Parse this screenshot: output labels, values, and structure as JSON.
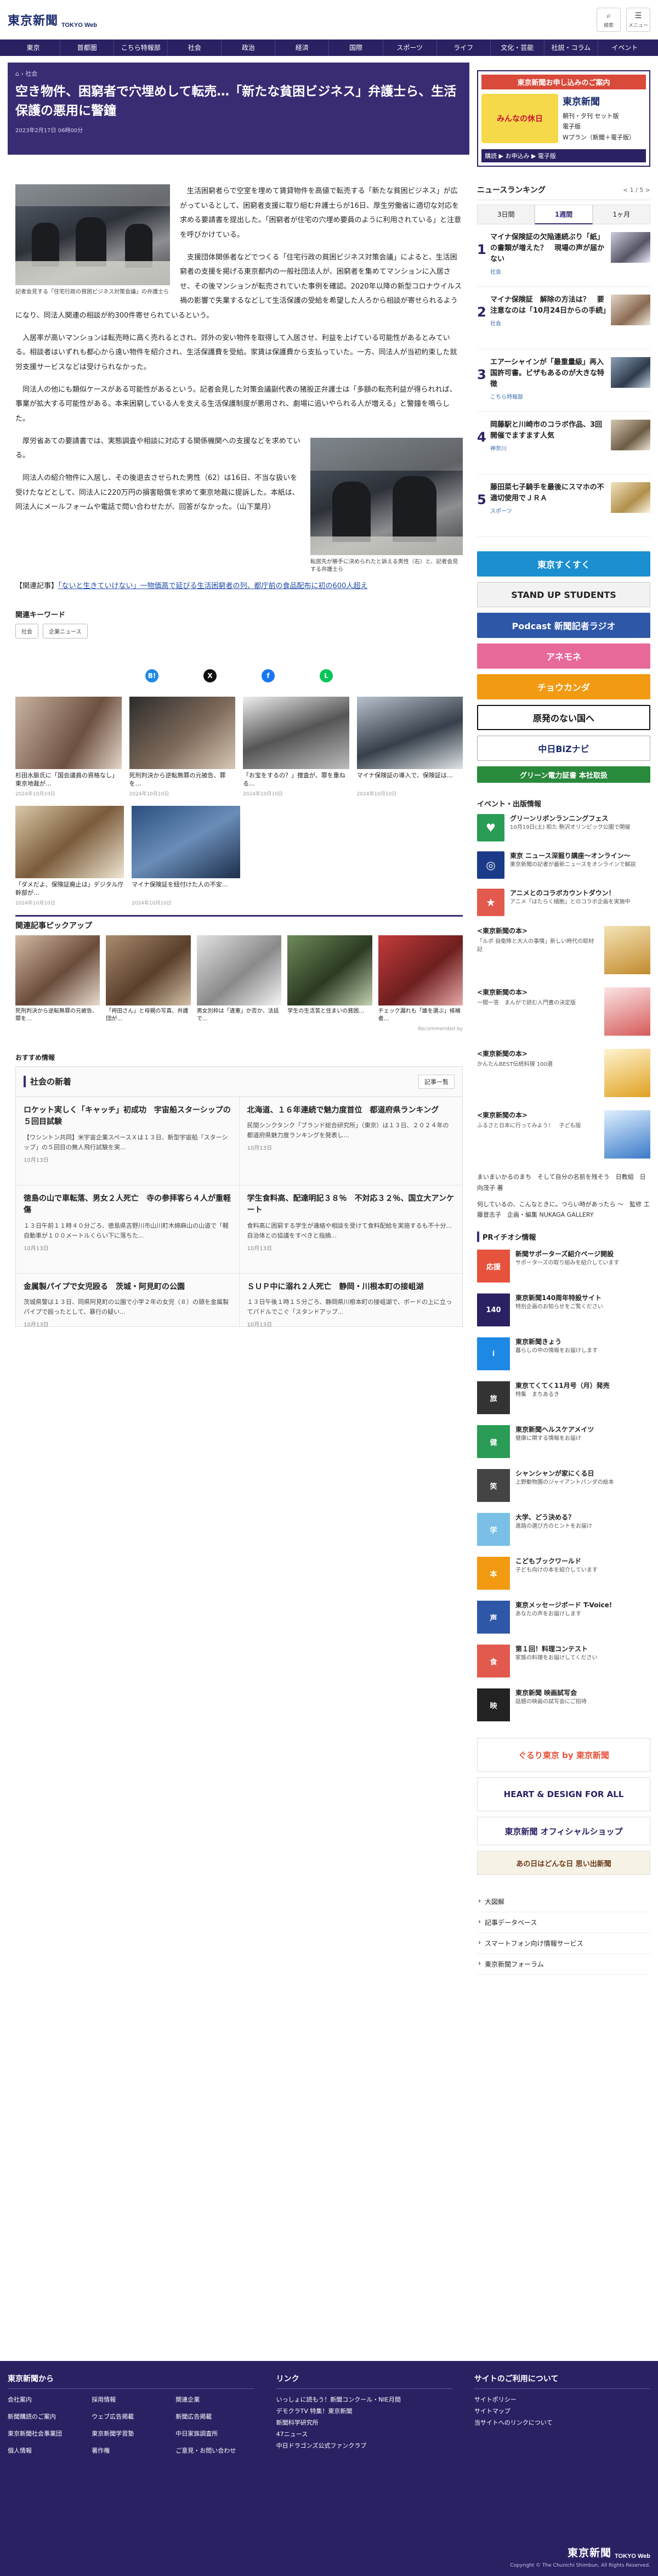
{
  "header": {
    "logo_jp": "東京新聞",
    "logo_en": "TOKYO Web",
    "search_label": "検索",
    "menu_label": "メニュー"
  },
  "nav": [
    "東京",
    "首都圏",
    "こちら特報部",
    "社会",
    "政治",
    "経済",
    "国際",
    "スポーツ",
    "ライフ",
    "文化・芸能",
    "社説・コラム",
    "イベント"
  ],
  "article": {
    "breadcrumb": "社会",
    "title": "空き物件、困窮者で穴埋めして転売…「新たな貧困ビジネス」弁護士ら、生活保護の悪用に警鐘",
    "date": "2023年2月17日 06時00分",
    "fig1_caption": "記者会見する「住宅行政の貧困ビジネス対策会議」の弁護士ら",
    "fig2_caption": "転居先が勝手に決められたと訴える男性（右）と、記者会見する弁護士ら",
    "paragraphs": [
      "生活困窮者らで空室を埋めて賃貸物件を高値で転売する「新たな貧困ビジネス」が広がっているとして、困窮者支援に取り組む弁護士らが16日、厚生労働省に適切な対応を求める要請書を提出した。「困窮者が住宅の穴埋め要員のように利用されている」と注意を呼びかけている。",
      "支援団体関係者などでつくる「住宅行政の貧困ビジネス対策会議」によると、生活困窮者の支援を掲げる東京都内の一般社団法人が、困窮者を集めてマンションに入居させ、その後マンションが転売されていた事例を確認。2020年以降の新型コロナウイルス禍の影響で失業するなどして生活保護の受給を希望した人ろから相談が寄せられるようになり、同法人関連の相談が約300件寄せられているという。",
      "入居率が高いマンションは転売時に高く売れるとされ、郊外の安い物件を取得して入居させ、利益を上げている可能性があるとみている。相談者はいずれも都心から遠い物件を紹介され、生活保護費を受給。家賃は保護費から支払っていた。一方、同法人が当初約束した就労支援サービスなどは受けられなかった。",
      "同法人の他にも類似ケースがある可能性があるという。記者会見した対策会議副代表の猪股正弁護士は「多額の転売利益が得られれば、事業が拡大する可能性がある。本来困窮している人を支える生活保護制度が悪用され、劇場に追いやられる人が増える」と警鐘を鳴らした。",
      "厚労省あての要請書では、実態調査や相談に対応する関係機関への支援などを求めている。",
      "同法人の紹介物件に入居し、その後退去させられた男性（62）は16日、不当な扱いを受けたなどとして、同法人に220万円の損害賠償を求めて東京地裁に提訴した。本紙は、同法人にメールフォームや電話で問い合わせたが、回答がなかった。（山下葉月）"
    ],
    "related_prefix": "【関連記事】",
    "related_link": "「ないと生きていけない」一物価高で延びる生活困窮者の列、都庁前の食品配布に初の600人超え"
  },
  "keywords": {
    "heading": "関連キーワード",
    "items": [
      "社会",
      "企業ニュース"
    ]
  },
  "share": [
    "B!",
    "X",
    "f",
    "L"
  ],
  "cards_row1": [
    {
      "title": "杉田水脈氏に「国会議員の資格なし」東京地裁が…",
      "date": "2024年10月10日"
    },
    {
      "title": "死刑判決から逆転無罪の元被告、罪を…",
      "date": "2024年10月10日"
    },
    {
      "title": "「お宝をするの？」捜査が、罪を重ねる…",
      "date": "2024年10月10日"
    },
    {
      "title": "マイナ保険証の導入で、保険証は…",
      "date": "2024年10月10日"
    }
  ],
  "cards_row2": [
    {
      "title": "「ダメだよ、保険証廃止は」デジタル庁幹部が…",
      "date": "2024年10月10日"
    },
    {
      "title": "マイナ保険証を紐付けた人の不安…",
      "date": "2024年10月10日"
    }
  ],
  "pickup": {
    "heading": "関連記事ピックアップ",
    "items": [
      {
        "title": "死刑判決から逆転無罪の元被告、罪を…"
      },
      {
        "title": "「袴田さん」と母親の写真、弁護団が…"
      },
      {
        "title": "男女別枠は「違憲」か否か、法廷で…"
      },
      {
        "title": "学生の生活苦と住まいの貧困…"
      },
      {
        "title": "チェック漏れも「誰を選ぶ」候補者…"
      }
    ],
    "reco": "Recommended by"
  },
  "osusume": "おすすめ情報",
  "social_news": {
    "heading": "社会の新着",
    "more": "記事一覧",
    "items": [
      {
        "title": "ロケット実しく「キャッチ」初成功　宇宙船スターシップの５回目試験",
        "summary": "【ワシントン共同】米宇宙企業スペースＸは１３日、新型宇宙船「スターシップ」の５回目の無人飛行試験を実...",
        "date": "10月13日"
      },
      {
        "title": "北海道、１６年連続で魅力度首位　都道府県ランキング",
        "summary": "民間シンクタンク「ブランド総合研究所」（東京）は１３日、２０２４年の都道府県魅力度ランキングを発表し...",
        "date": "10月13日"
      },
      {
        "title": "徳島の山で車転落、男女２人死亡　寺の参拝客ら４人が重軽傷",
        "summary": "１３日午前１１時４０分ごろ、徳島県吉野川市山川町木綿麻山の山道で「軽自動車が１００メートルくらい下に落ちた...",
        "date": "10月13日"
      },
      {
        "title": "学生食料高、配達明記３８％　不対応３２％、国立大アンケート",
        "summary": "食料高に困窮する学生が連絡や相談を受けて食料配給を実施するも不十分…自治体との協議をすべきと指摘...",
        "date": "10月13日"
      },
      {
        "title": "金属製パイプで女児殴る　茨城・阿見町の公園",
        "summary": "茨城県警は１３日、同県阿見町の公園で小学２年の女児（８）の頭を金属製パイプで殴ったとして、暴行の疑い...",
        "date": "10月13日"
      },
      {
        "title": "ＳＵＰ中に溺れ２人死亡　静岡・川根本町の接岨湖",
        "summary": "１３日午後１時１５分ごろ、静岡県川根本町の接岨湖で、ボードの上に立ってパドルでこぐ「スタンドアップ...",
        "date": "10月13日"
      }
    ]
  },
  "side_ad": {
    "top": "東京新聞お申し込みのご案内",
    "left": "みんなの休日",
    "brand": "東京新聞",
    "lines": [
      "朝刊・夕刊 セット版",
      "電子版",
      "Wプラン（新聞＋電子版）"
    ],
    "bottom": "購読 ▶ お申込み ▶ 電子版"
  },
  "ranking": {
    "heading": "ニュースランキング",
    "nav": "< 1 / 5 >",
    "tabs": [
      "3日間",
      "1週間",
      "1ヶ月"
    ],
    "items": [
      {
        "rank": "1",
        "title": "マイナ保険証の欠陥連続ぶり「紙」の書類が増えた？　現場の声が届かない",
        "cat": "社会"
      },
      {
        "rank": "2",
        "title": "マイナ保険証　解除の方法は？　要注意なのは「10月24日からの手続」",
        "cat": "社会"
      },
      {
        "rank": "3",
        "title": "エアーシャインが「最重量級」再入国許可書。ビザもあるのが大きな特徴",
        "cat": "こちら特報部"
      },
      {
        "rank": "4",
        "title": "岡藤駅と川崎市のコラボ作品、3回開催でますます人気",
        "cat": "神奈川"
      },
      {
        "rank": "5",
        "title": "藤田菜七子騎手を最後にスマホの不適切使用でＪＲＡ",
        "cat": "スポーツ"
      }
    ]
  },
  "banners": [
    "東京すくすく",
    "STAND UP STUDENTS",
    "Podcast 新聞記者ラジオ",
    "アネモネ",
    "チョウカンダ",
    "原発のない国へ",
    "中日BiZナビ",
    "グリーン電力証書 本社取扱"
  ],
  "events": {
    "heading": "イベント・出版情報",
    "items": [
      {
        "title": "グリーンリボンランニングフェス",
        "sub": "10月19日(土) 和た 駒沢オリンピック公園で開催"
      },
      {
        "title": "東京 ニュース深掘り講座〜オンライン〜",
        "sub": "東京新聞の記者が最新ニュースをオンラインで解説"
      },
      {
        "title": "アニメとのコラボカウントダウン！",
        "sub": "アニメ「はたらく細胞」とのコラボ企画を実施中"
      }
    ]
  },
  "tokyo_books": [
    {
      "title": "<東京新聞の本>",
      "sub": "「ルポ 自衛隊と大人の事情」新しい時代の取材記"
    },
    {
      "title": "<東京新聞の本>",
      "sub": "一間一答　まんがで読む入門書の決定版"
    },
    {
      "title": "<東京新聞の本>",
      "sub": "かんたんBEST伝統料理 100選"
    },
    {
      "title": "<東京新聞の本>",
      "sub": "ふるさと日本に行ってみよう！　子ども版"
    }
  ],
  "manga_note": "まいまいかるのまち　そして自分の名前を残そう　日教組　日向茂子 著",
  "manga_note2": "何しているの、こんなときに。つらい時があったら 〜　監修 工藤登志子　企画・編集 NUKAGA GALLERY",
  "pr": {
    "heading": "PRイチオシ情報",
    "items": [
      {
        "icon": "応援",
        "title": "新聞サポーターズ紹介ページ開設",
        "sub": "サポーターズの取り組みを紹介しています"
      },
      {
        "icon": "140",
        "title": "東京新聞140周年特設サイト",
        "sub": "特別企画のお知らせをご覧ください"
      },
      {
        "icon": "i",
        "title": "東京新聞きょう",
        "sub": "暮らしの中の情報をお届けします"
      },
      {
        "icon": "旅",
        "title": "東京てくてく11月号（月）発売",
        "sub": "特集　まちあるき"
      },
      {
        "icon": "健",
        "title": "東京新聞ヘルスケアメイツ",
        "sub": "健康に関する情報をお届け"
      },
      {
        "icon": "笑",
        "title": "シャンシャンが家にくる日",
        "sub": "上野動物園のジャイアントパンダの絵本"
      },
      {
        "icon": "学",
        "title": "大学、どう決める？",
        "sub": "進路の選び方のヒントをお届け"
      },
      {
        "icon": "本",
        "title": "こどもブックワールド",
        "sub": "子ども向けの本を紹介しています"
      },
      {
        "icon": "声",
        "title": "東京メッセージボード T-Voice!",
        "sub": "あなたの声をお届けします"
      },
      {
        "icon": "食",
        "title": "第１回！料理コンテスト",
        "sub": "家族の料理をお届けしてください"
      },
      {
        "icon": "映",
        "title": "東京新聞 映画試写会",
        "sub": "話題の映画の試写会にご招待"
      }
    ]
  },
  "side_banners": [
    "ぐるり東京 by 東京新聞",
    "HEART & DESIGN FOR ALL",
    "東京新聞 オフィシャルショップ",
    "あの日はどんな日 思い出新聞"
  ],
  "side_links": [
    "大図解",
    "記事データベース",
    "スマートフォン向け情報サービス",
    "東京新聞フォーラム"
  ],
  "footer": {
    "col1_heading": "東京新聞から",
    "col1_links": [
      "会社案内",
      "採用情報",
      "新聞購読のご案内",
      "ウェブ広告掲載",
      "東京新聞社会事業団",
      "東京新聞学習塾",
      "個人情報",
      "著作権",
      "関連企業",
      "新聞広告掲載",
      "中日家族調査所",
      "ご意見・お問い合わせ"
    ],
    "col2_heading": "リンク",
    "col2_links": [
      "いっしょに読もう！新聞コンクール・NIE月間",
      "デモクラTV 特集！東京新聞",
      "新聞科学研究所",
      "47ニュース",
      "中日ドラゴンズ公式ファンクラブ"
    ],
    "col3_heading": "サイトのご利用について",
    "col3_links": [
      "サイトポリシー",
      "サイトマップ",
      "当サイトへのリンクについて"
    ],
    "logo_jp": "東京新聞",
    "logo_en": "TOKYO Web",
    "copyright": "Copyright © The Chunichi Shimbun, All Rights Reserved."
  },
  "colors": {
    "brand": "#2a2163",
    "band": "#3a2c73",
    "link": "#1f4aa8"
  }
}
